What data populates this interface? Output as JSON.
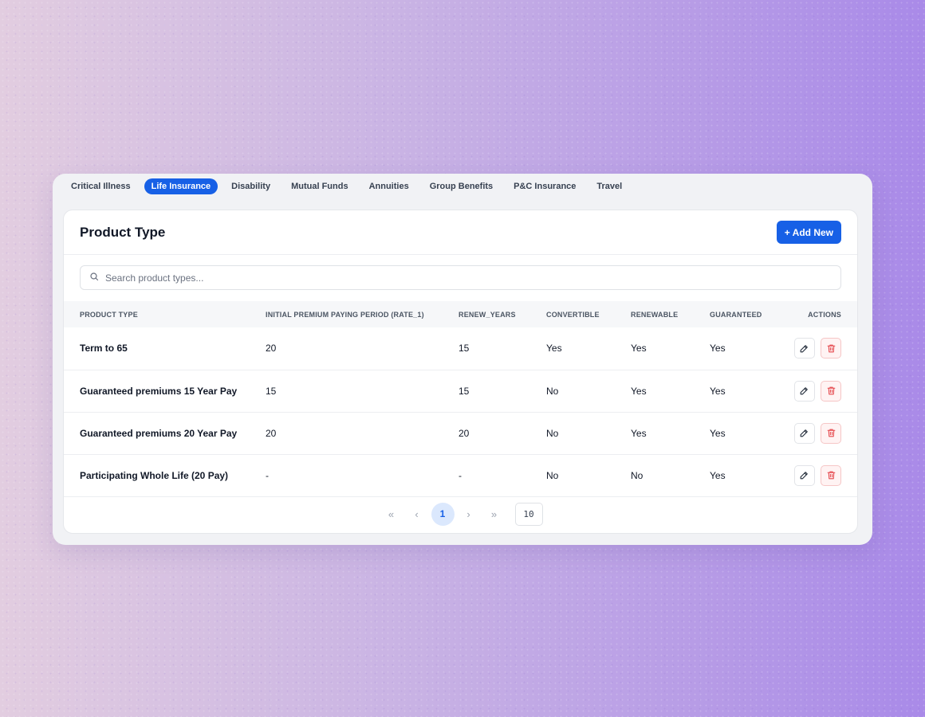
{
  "tabs": [
    {
      "label": "Critical Illness",
      "active": false
    },
    {
      "label": "Life Insurance",
      "active": true
    },
    {
      "label": "Disability",
      "active": false
    },
    {
      "label": "Mutual Funds",
      "active": false
    },
    {
      "label": "Annuities",
      "active": false
    },
    {
      "label": "Group Benefits",
      "active": false
    },
    {
      "label": "P&C Insurance",
      "active": false
    },
    {
      "label": "Travel",
      "active": false
    }
  ],
  "card": {
    "title": "Product Type",
    "add_label": "+ Add New"
  },
  "search": {
    "placeholder": "Search product types...",
    "icon": "search-icon"
  },
  "table": {
    "columns": [
      "PRODUCT TYPE",
      "INITIAL PREMIUM PAYING PERIOD (RATE_1)",
      "RENEW_YEARS",
      "CONVERTIBLE",
      "RENEWABLE",
      "GUARANTEED",
      "ACTIONS"
    ],
    "rows": [
      [
        "Term to 65",
        "20",
        "15",
        "Yes",
        "Yes",
        "Yes"
      ],
      [
        "Guaranteed premiums 15 Year Pay",
        "15",
        "15",
        "No",
        "Yes",
        "Yes"
      ],
      [
        "Guaranteed premiums 20 Year Pay",
        "20",
        "20",
        "No",
        "Yes",
        "Yes"
      ],
      [
        "Participating Whole Life (20 Pay)",
        "-",
        "-",
        "No",
        "No",
        "Yes"
      ]
    ],
    "row_action_icons": [
      "pencil-icon",
      "trash-icon"
    ]
  },
  "pagination": {
    "first": "«",
    "prev": "‹",
    "current": "1",
    "next": "›",
    "last": "»",
    "page_size": "10"
  },
  "colors": {
    "accent": "#1760e6",
    "danger": "#e5484d"
  }
}
